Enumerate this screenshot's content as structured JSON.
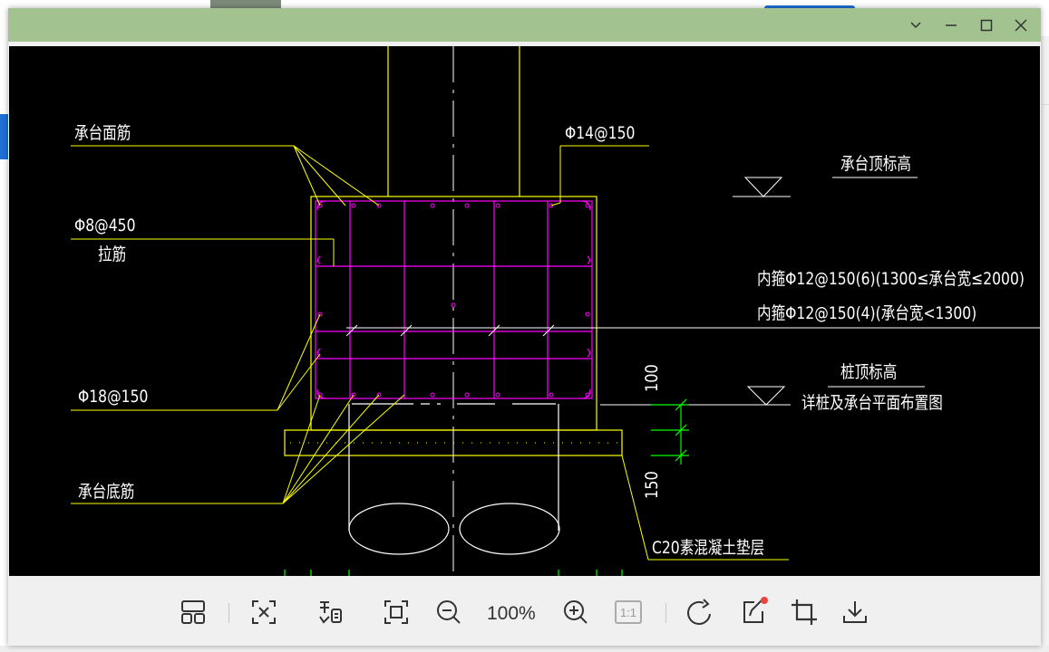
{
  "window": {
    "title_bar_color": "#a2c28f",
    "controls": [
      "chevron-down",
      "minimize",
      "maximize",
      "close"
    ]
  },
  "drawing": {
    "labels": {
      "top_bars": "承台面筋",
      "stirrup_top": "Φ14@150",
      "cap_top_elev": "承台顶标高",
      "tie_bar_spec": "Φ8@450",
      "tie_bar": "拉筋",
      "inner_stirrup_1": "内箍Φ12@150(6)(1300≤承台宽≤2000)",
      "inner_stirrup_2": "内箍Φ12@150(4)(承台宽<1300)",
      "pile_top_elev": "桩顶标高",
      "pile_plan_note": "详桩及承台平面布置图",
      "side_bars": "Φ18@150",
      "bottom_bars": "承台底筋",
      "cushion": "C20素混凝土垫层",
      "dim_100": "100",
      "dim_150": "150"
    },
    "colors": {
      "background": "#000000",
      "outline": "#ffff00",
      "rebar": "#ff00ff",
      "text": "#ffffff",
      "dimension": "#00ff00"
    }
  },
  "toolbar": {
    "zoom_level": "100%",
    "actual_size_label": "1:1",
    "tools": [
      "thumbnail",
      "fit-page",
      "ocr",
      "fullscreen",
      "zoom-out",
      "zoom-in",
      "actual-size",
      "rotate",
      "edit",
      "crop",
      "download"
    ]
  }
}
